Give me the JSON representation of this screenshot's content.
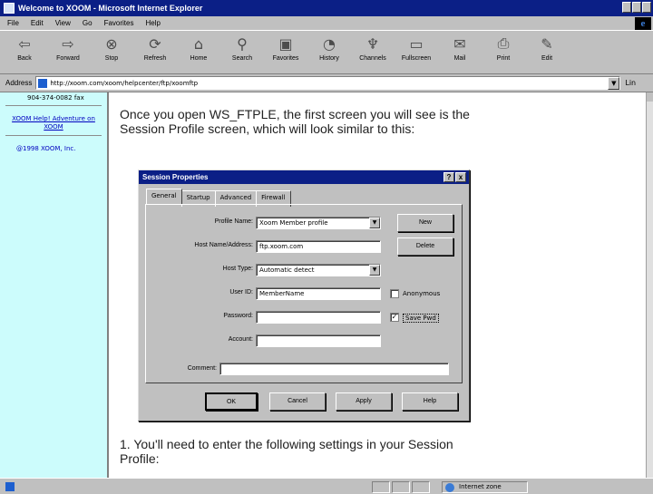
{
  "window": {
    "title": "Welcome to XOOM - Microsoft Internet Explorer"
  },
  "menu": [
    "File",
    "Edit",
    "View",
    "Go",
    "Favorites",
    "Help"
  ],
  "toolbar": [
    {
      "label": "Back",
      "icon": "back-arrow"
    },
    {
      "label": "Forward",
      "icon": "forward-arrow"
    },
    {
      "label": "Stop",
      "icon": "stop"
    },
    {
      "label": "Refresh",
      "icon": "refresh"
    },
    {
      "label": "Home",
      "icon": "home"
    },
    {
      "label": "Search",
      "icon": "search"
    },
    {
      "label": "Favorites",
      "icon": "favorites"
    },
    {
      "label": "History",
      "icon": "history"
    },
    {
      "label": "Channels",
      "icon": "channels"
    },
    {
      "label": "Fullscreen",
      "icon": "fullscreen"
    },
    {
      "label": "Mail",
      "icon": "mail"
    },
    {
      "label": "Print",
      "icon": "print"
    },
    {
      "label": "Edit",
      "icon": "edit"
    }
  ],
  "address": {
    "label": "Address",
    "url": "http://xoom.com/xoom/helpcenter/ftp/xoomftp",
    "links_label": "Lin"
  },
  "sidebar": {
    "phone": "904-374-0082 fax",
    "help_link": "XOOM Help! Adventure on XOOM",
    "copyright": "@1998 XOOM, Inc."
  },
  "content": {
    "para1": "Once you open WS_FTPLE, the first screen you will see is the Session Profile screen, which will look similar to this:",
    "para2": "1. You'll need to enter the following settings in your Session Profile:"
  },
  "dialog": {
    "title": "Session Properties",
    "help_btn": "?",
    "close_btn": "x",
    "tabs": [
      "General",
      "Startup",
      "Advanced",
      "Firewall"
    ],
    "profile_name": {
      "label": "Profile Name:",
      "value": "Xoom Member profile"
    },
    "host_name": {
      "label": "Host Name/Address:",
      "value": "ftp.xoom.com"
    },
    "host_type": {
      "label": "Host Type:",
      "value": "Automatic detect"
    },
    "user_id": {
      "label": "User ID:",
      "value": "MemberName"
    },
    "password": {
      "label": "Password:",
      "value": ""
    },
    "account": {
      "label": "Account:",
      "value": ""
    },
    "comment": {
      "label": "Comment:",
      "value": ""
    },
    "new_btn": "New",
    "delete_btn": "Delete",
    "anonymous": {
      "label": "Anonymous",
      "checked": false,
      "mark": ""
    },
    "save_pwd": {
      "label": "Save Pwd",
      "checked": true,
      "mark": "✓"
    },
    "ok_btn": "OK",
    "cancel_btn": "Cancel",
    "apply_btn": "Apply",
    "help_btn2": "Help"
  },
  "status": {
    "zone": "Internet zone"
  }
}
